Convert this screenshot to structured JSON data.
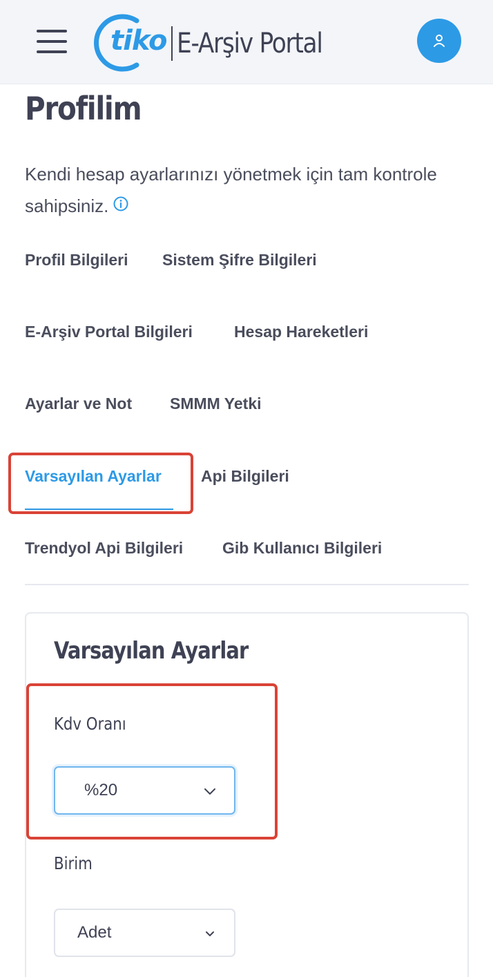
{
  "header": {
    "logo_word": "tiko",
    "logo_text": "E-Arşiv Portal",
    "avatar_icon": "user-icon"
  },
  "page": {
    "title": "Profilim",
    "description": "Kendi hesap ayarlarınızı yönetmek için tam kontrole sahipsiniz.",
    "info_icon": "info-circle-icon"
  },
  "tabs": [
    {
      "label": "Profil Bilgileri",
      "active": false
    },
    {
      "label": "Sistem Şifre Bilgileri",
      "active": false
    },
    {
      "label": "E-Arşiv Portal Bilgileri",
      "active": false
    },
    {
      "label": "Hesap Hareketleri",
      "active": false
    },
    {
      "label": "Ayarlar ve Not",
      "active": false
    },
    {
      "label": "SMMM Yetki",
      "active": false
    },
    {
      "label": "Varsayılan Ayarlar",
      "active": true
    },
    {
      "label": "Api Bilgileri",
      "active": false
    },
    {
      "label": "Trendyol Api Bilgileri",
      "active": false
    },
    {
      "label": "Gib Kullanıcı Bilgileri",
      "active": false
    }
  ],
  "card": {
    "title": "Varsayılan Ayarlar",
    "fields": [
      {
        "label": "Kdv Oranı",
        "value": "%20"
      },
      {
        "label": "Birim",
        "value": "Adet"
      }
    ]
  },
  "colors": {
    "accent": "#2d9ae6",
    "highlight": "#d94336",
    "text": "#3f4254"
  }
}
